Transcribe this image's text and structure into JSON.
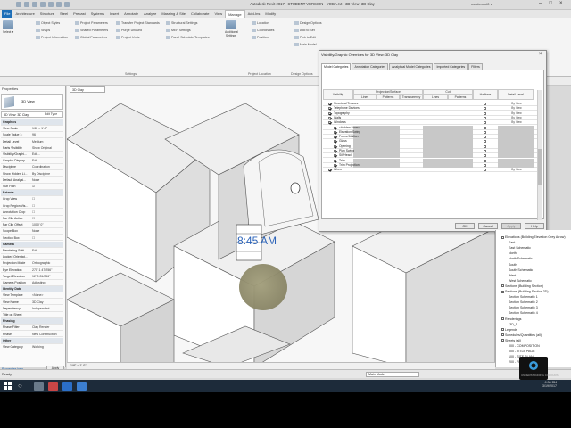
{
  "titlebar": {
    "title": "Autodesk Revit 2017 - STUDENT VERSION - YOBA.rvt - 3D View: 3D Clay",
    "user": "maclemint0 ▾"
  },
  "ribbon_tabs": [
    "File",
    "Architecture",
    "Structure",
    "Steel",
    "Precast",
    "Systems",
    "Insert",
    "Annotate",
    "Analyze",
    "Massing & Site",
    "Collaborate",
    "View",
    "Manage",
    "Add-Ins",
    "Modify",
    ""
  ],
  "ribbon_active": "Manage",
  "ribbon": {
    "select_label": "Select ▾",
    "group_settings": "Settings",
    "group_location": "Project Location",
    "group_design": "Design Options",
    "items": [
      "Object Styles",
      "Project Parameters",
      "Transfer Project Standards",
      "Additional Settings",
      "Location",
      "Snaps",
      "Shared Parameters",
      "Purge Unused",
      "Project Units",
      "Coordinates",
      "Project Information",
      "Global Parameters",
      "Structural Settings",
      "MEP Settings",
      "Panel Schedule Templates",
      "Position",
      "Design Options",
      "Add to Set",
      "Pick to Edit",
      "Main Model"
    ]
  },
  "properties": {
    "title": "Properties",
    "type": "3D View",
    "filter": "3D View: 3D Clay",
    "edit_type": "Edit Type",
    "rows": [
      {
        "k": "Graphics",
        "v": "",
        "sec": true
      },
      {
        "k": "View Scale",
        "v": "1/8\" = 1'-0\""
      },
      {
        "k": "Scale Value 1:",
        "v": "96"
      },
      {
        "k": "Detail Level",
        "v": "Medium"
      },
      {
        "k": "Parts Visibility",
        "v": "Show Original"
      },
      {
        "k": "Visibility/Graphi...",
        "v": "Edit..."
      },
      {
        "k": "Graphic Display...",
        "v": "Edit..."
      },
      {
        "k": "Discipline",
        "v": "Coordination"
      },
      {
        "k": "Show Hidden Li...",
        "v": "By Discipline"
      },
      {
        "k": "Default Analysi...",
        "v": "None"
      },
      {
        "k": "Sun Path",
        "v": "☑"
      },
      {
        "k": "Extents",
        "v": "",
        "sec": true
      },
      {
        "k": "Crop View",
        "v": "☐"
      },
      {
        "k": "Crop Region Vis...",
        "v": "☐"
      },
      {
        "k": "Annotation Crop",
        "v": "☐"
      },
      {
        "k": "Far Clip Active",
        "v": "☐"
      },
      {
        "k": "Far Clip Offset",
        "v": "1000' 0\""
      },
      {
        "k": "Scope Box",
        "v": "None"
      },
      {
        "k": "Section Box",
        "v": "☐"
      },
      {
        "k": "Camera",
        "v": "",
        "sec": true
      },
      {
        "k": "Rendering Setti...",
        "v": "Edit..."
      },
      {
        "k": "Locked Orientat...",
        "v": ""
      },
      {
        "k": "Projection Mode",
        "v": "Orthographic"
      },
      {
        "k": "Eye Elevation",
        "v": "270' 1 47/256\""
      },
      {
        "k": "Target Elevation",
        "v": "12' 3 81/256\""
      },
      {
        "k": "Camera Position",
        "v": "Adjusting"
      },
      {
        "k": "Identity Data",
        "v": "",
        "sec": true
      },
      {
        "k": "View Template",
        "v": "<None>"
      },
      {
        "k": "View Name",
        "v": "3D Clay"
      },
      {
        "k": "Dependency",
        "v": "Independent"
      },
      {
        "k": "Title on Sheet",
        "v": ""
      },
      {
        "k": "Phasing",
        "v": "",
        "sec": true
      },
      {
        "k": "Phase Filter",
        "v": "Clay Render"
      },
      {
        "k": "Phase",
        "v": "New Construction"
      },
      {
        "k": "Other",
        "v": "",
        "sec": true
      },
      {
        "k": "View Category",
        "v": "Working"
      }
    ],
    "help": "Properties help",
    "apply": "Apply"
  },
  "viewport": {
    "tab": "3D Clay",
    "time": "8:45 AM",
    "bar": "1/8\" = 1'-0\""
  },
  "dialog": {
    "title": "Visibility/Graphic Overrides for 3D View: 3D Clay",
    "tabs": [
      "Model Categories",
      "Annotation Categories",
      "Analytical Model Categories",
      "Imported Categories",
      "Filters"
    ],
    "head": {
      "visibility": "Visibility",
      "proj": "Projection/Surface",
      "cut": "Cut",
      "lines": "Lines",
      "patterns": "Patterns",
      "transparency": "Transparency",
      "halftone": "Halftone",
      "detail": "Detail Level"
    },
    "rows": [
      {
        "label": "Structural Trusses",
        "on": true,
        "sub": false,
        "ov": "By View"
      },
      {
        "label": "Telephone Devices",
        "on": true,
        "sub": false,
        "ov": "By View"
      },
      {
        "label": "Topography",
        "on": true,
        "sub": false,
        "ov": "By View"
      },
      {
        "label": "Walls",
        "on": true,
        "sub": false,
        "ov": "By View"
      },
      {
        "label": "Windows",
        "on": true,
        "sub": false,
        "ov": "By View"
      },
      {
        "label": "<Hidden Lines>",
        "on": true,
        "sub": true,
        "ov": ""
      },
      {
        "label": "Elevation Swing",
        "on": true,
        "sub": true,
        "ov": ""
      },
      {
        "label": "Frame/Mullion",
        "on": true,
        "sub": true,
        "ov": ""
      },
      {
        "label": "Glass",
        "on": true,
        "sub": true,
        "ov": ""
      },
      {
        "label": "Opening",
        "on": true,
        "sub": true,
        "ov": ""
      },
      {
        "label": "Plan Swing",
        "on": true,
        "sub": true,
        "ov": ""
      },
      {
        "label": "Sill/Head",
        "on": true,
        "sub": true,
        "ov": ""
      },
      {
        "label": "Trim",
        "on": true,
        "sub": true,
        "ov": ""
      },
      {
        "label": "Trim Projection",
        "on": true,
        "sub": true,
        "ov": ""
      },
      {
        "label": "Wires",
        "on": true,
        "sub": false,
        "ov": "By View"
      }
    ],
    "buttons": {
      "ok": "OK",
      "cancel": "Cancel",
      "apply": "Apply",
      "help": "Help"
    }
  },
  "browser": {
    "items": [
      {
        "t": "Elevations (Building Elevation Grey Arrow)",
        "lvl": 0
      },
      {
        "t": "East",
        "lvl": 1
      },
      {
        "t": "East Schematic",
        "lvl": 1
      },
      {
        "t": "North",
        "lvl": 1
      },
      {
        "t": "North Schematic",
        "lvl": 1
      },
      {
        "t": "South",
        "lvl": 1
      },
      {
        "t": "South Schematic",
        "lvl": 1
      },
      {
        "t": "West",
        "lvl": 1
      },
      {
        "t": "West Schematic",
        "lvl": 1
      },
      {
        "t": "Sections (Building Section)",
        "lvl": 0
      },
      {
        "t": "Sections (Building Section 3D)",
        "lvl": 0
      },
      {
        "t": "Section Schematic 1",
        "lvl": 1
      },
      {
        "t": "Section Schematic 2",
        "lvl": 1
      },
      {
        "t": "Section Schematic 3",
        "lvl": 1
      },
      {
        "t": "Section Schematic 4",
        "lvl": 1
      },
      {
        "t": "Renderings",
        "lvl": 0
      },
      {
        "t": "(3D_1",
        "lvl": 1
      },
      {
        "t": "Legends",
        "lvl": 0
      },
      {
        "t": "Schedules/Quantities (all)",
        "lvl": 0
      },
      {
        "t": "Sheets (all)",
        "lvl": 0
      },
      {
        "t": "000 - COMPOSITION",
        "lvl": 1
      },
      {
        "t": "000 - TITLE PAGE",
        "lvl": 1
      },
      {
        "t": "100 - SITE PLAN",
        "lvl": 1
      },
      {
        "t": "200 - ROOF PLAN",
        "lvl": 1
      }
    ]
  },
  "status": {
    "text": "Ready",
    "model": "Main Model"
  },
  "taskbar": {
    "search": "○",
    "time": "6:50 PM",
    "date": "3/19/2017"
  },
  "navcube": {
    "label": "UNDERSTANDING COLOURS"
  }
}
